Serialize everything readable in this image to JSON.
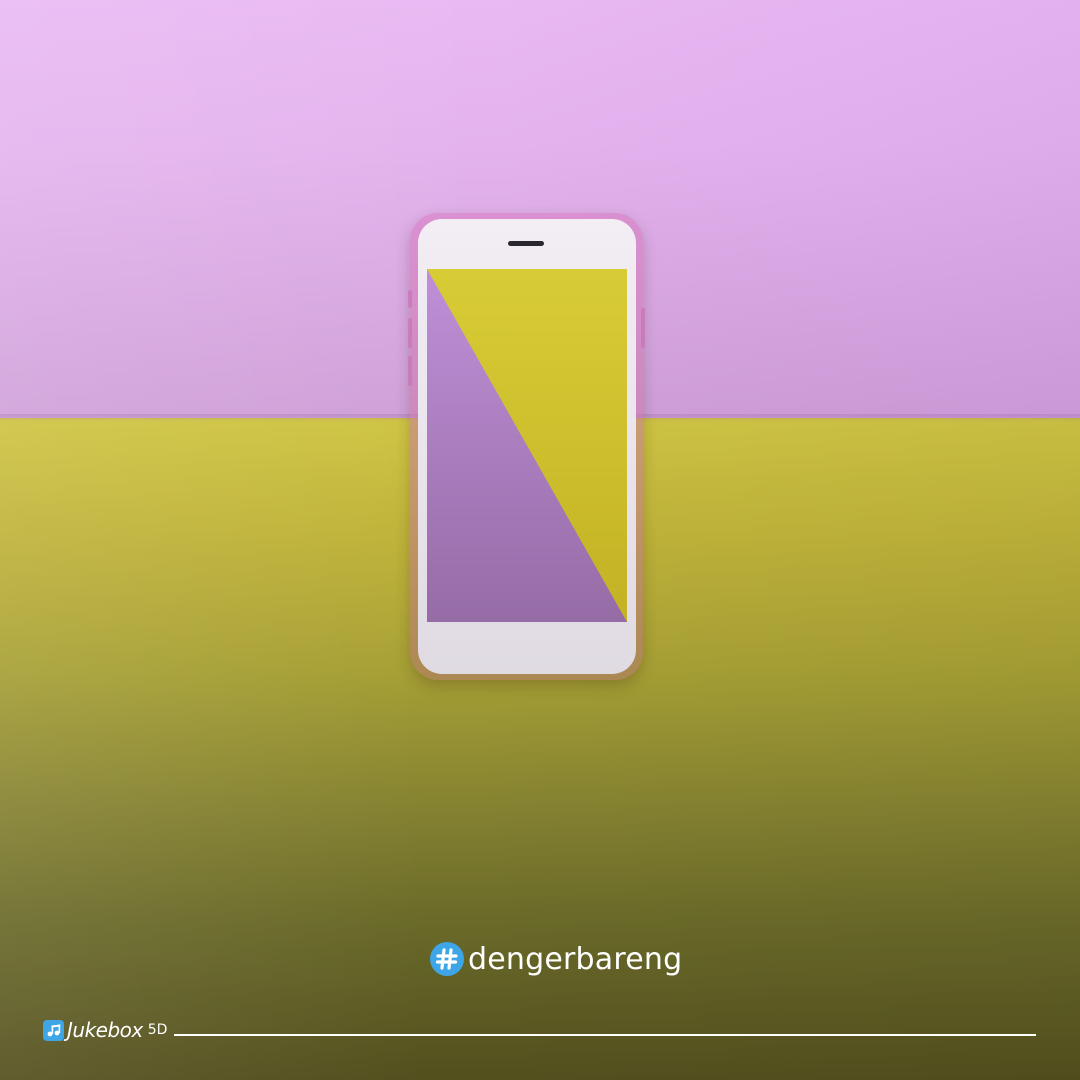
{
  "scene": {
    "description_colors": {
      "background_top": "#e4b3ee",
      "background_bottom": "#bfb33a",
      "screen_purple": "#b07fc8",
      "screen_yellow": "#d3c22f",
      "hashtag_badge": "#3ea6e6"
    }
  },
  "hashtag": {
    "icon": "hash-icon",
    "text": "dengerbareng"
  },
  "footer": {
    "logo_icon": "jukebox-note-icon",
    "brand": "Jukebox",
    "brand_suffix": "5D"
  }
}
